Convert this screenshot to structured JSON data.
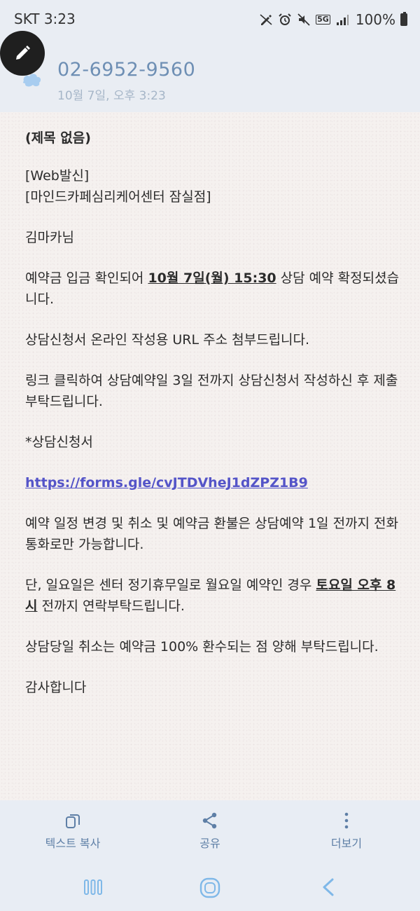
{
  "status_bar": {
    "carrier_time": "SKT 3:23",
    "network": "5G",
    "battery": "100%"
  },
  "header": {
    "sender": "02-6952-9560",
    "datetime": "10월 7일, 오후 3:23"
  },
  "message": {
    "subject": "(제목 없음)",
    "line_web": "[Web발신]",
    "line_center": "[마인드카페심리케어센터 잠실점]",
    "greeting": "김마카님",
    "confirm_pre": "예약금 입금 확인되어 ",
    "confirm_date": "10월 7일(월) 15:30",
    "confirm_post": " 상담 예약 확정되셨습니다.",
    "url_notice": "상담신청서 온라인 작성용 URL 주소 첨부드립니다.",
    "link_instruction": "링크 클릭하여 상담예약일 3일 전까지 상담신청서 작성하신 후 제출 부탁드립니다.",
    "form_label": "*상담신청서",
    "form_link": "https://forms.gle/cvJTDVheJ1dZPZ1B9",
    "change_policy": "예약 일정 변경 및 취소 및 예약금 환불은 상담예약 1일 전까지 전화통화로만 가능합니다.",
    "sunday_pre": "단, 일요일은 센터 정기휴무일로 월요일 예약인 경우 ",
    "sunday_deadline": "토요일 오후 8시",
    "sunday_post": " 전까지 연락부탁드립니다.",
    "same_day": "상담당일 취소는 예약금 100% 환수되는 점  양해 부탁드립니다.",
    "thanks": "감사합니다"
  },
  "actions": {
    "copy_text": "텍스트 복사",
    "share": "공유",
    "more": "더보기"
  },
  "icons": {
    "edit": "pencil-icon",
    "copy": "copy-icon",
    "share": "share-icon",
    "more": "more-vertical-icon",
    "recents": "recents-icon",
    "home": "home-icon",
    "back": "back-icon"
  },
  "colors": {
    "sender": "#6e8fb4",
    "link": "#5454c8",
    "action": "#5e7fa6"
  }
}
